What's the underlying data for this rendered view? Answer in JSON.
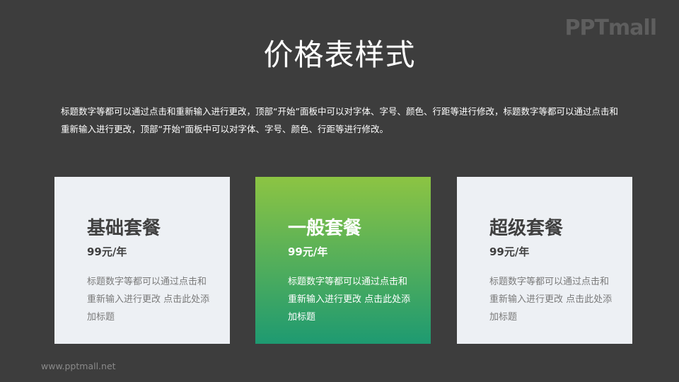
{
  "logo": {
    "text": "PPTmall"
  },
  "title": "价格表样式",
  "description": "标题数字等都可以通过点击和重新输入进行更改，顶部“开始”面板中可以对字体、字号、颜色、行距等进行修改，标题数字等都可以通过点击和重新输入进行更改，顶部“开始”面板中可以对字体、字号、颜色、行距等进行修改。",
  "cards": [
    {
      "name": "基础套餐",
      "price": "99元/年",
      "text": "标题数字等都可以通过点击和重新输入进行更改 点击此处添加标题"
    },
    {
      "name": "一般套餐",
      "price": "99元/年",
      "text": "标题数字等都可以通过点击和重新输入进行更改 点击此处添加标题"
    },
    {
      "name": "超级套餐",
      "price": "99元/年",
      "text": "标题数字等都可以通过点击和重新输入进行更改 点击此处添加标题"
    }
  ],
  "footer": "www.pptmall.net",
  "colors": {
    "background": "#3d3d3d",
    "card": "#edf0f4",
    "highlight_top": "#8cc443",
    "highlight_bottom": "#1e9a71"
  }
}
